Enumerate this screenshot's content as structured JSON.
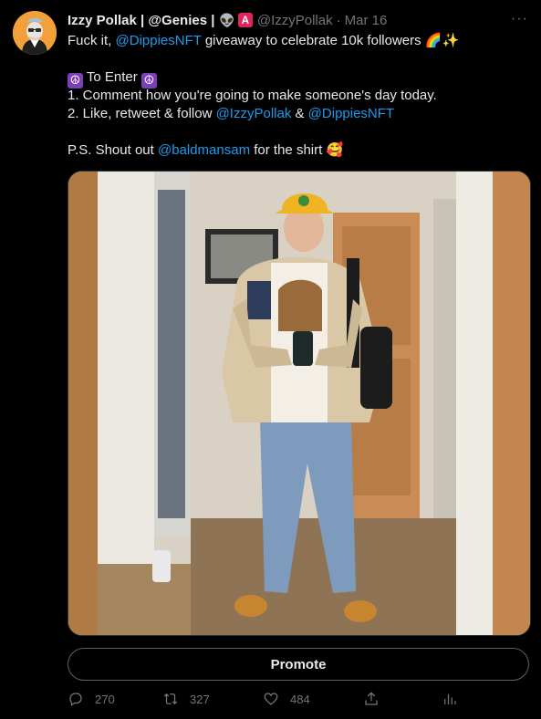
{
  "author": {
    "display_name": "Izzy Pollak | @Genies |",
    "badge_emoji": "👽",
    "badge_letter": "A",
    "handle": "@IzzyPollak",
    "separator": "·",
    "date": "Mar 16"
  },
  "more_icon": "···",
  "body": {
    "line1_prefix": "Fuck it, ",
    "line1_link": "@DippiesNFT",
    "line1_suffix": " giveaway to celebrate 10k followers ",
    "line1_emoji": "🌈✨",
    "peace_glyph": "☮",
    "to_enter": " To Enter ",
    "step1": "1. Comment how you're going to make someone's day today.",
    "step2_prefix": "2. Like, retweet & follow ",
    "step2_link1": "@IzzyPollak",
    "step2_mid": " & ",
    "step2_link2": "@DippiesNFT",
    "ps_prefix": "P.S. Shout out ",
    "ps_link": "@baldmansam",
    "ps_suffix": " for the shirt ",
    "ps_emoji": "🥰"
  },
  "promote_label": "Promote",
  "actions": {
    "replies": "270",
    "retweets": "327",
    "likes": "484"
  },
  "colors": {
    "background": "#000000",
    "text": "#e7e9ea",
    "muted": "#71767b",
    "link": "#1d9bf0",
    "border": "#536471"
  }
}
